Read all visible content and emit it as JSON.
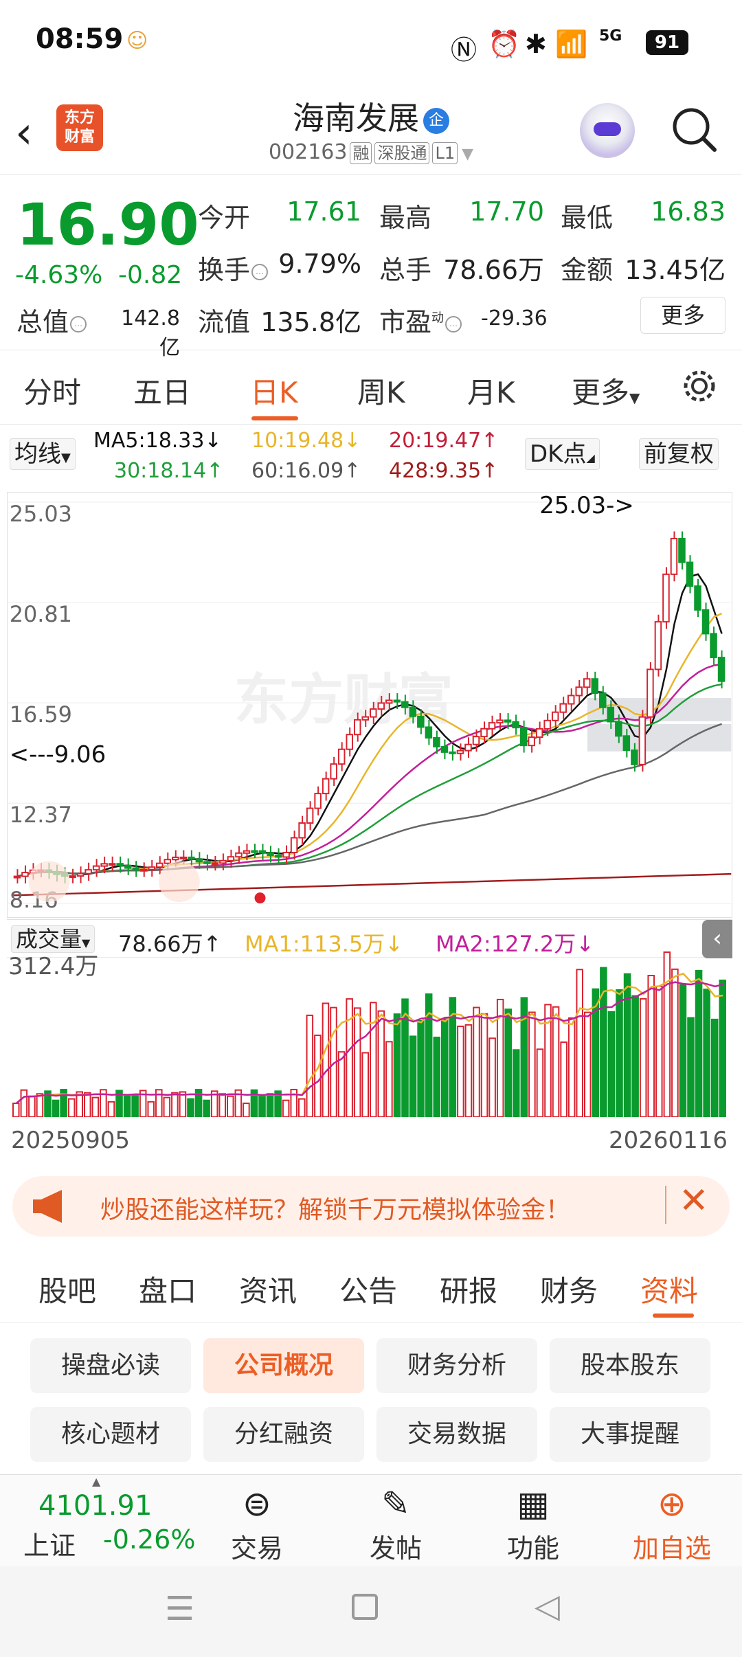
{
  "status_bar": {
    "time": "08:59",
    "battery": "91",
    "network": "5G"
  },
  "header": {
    "name": "海南发展",
    "qi_badge": "企",
    "code": "002163",
    "tags": [
      "融",
      "深股通",
      "L1"
    ],
    "logo_text_1": "东方",
    "logo_text_2": "财富"
  },
  "quote": {
    "price": "16.90",
    "change_pct": "-4.63%",
    "change": "-0.82",
    "open_label": "今开",
    "open": "17.61",
    "high_label": "最高",
    "high": "17.70",
    "low_label": "最低",
    "low": "16.83",
    "turnover_label": "换手",
    "turnover": "9.79%",
    "volume_label": "总手",
    "volume": "78.66万",
    "amount_label": "金额",
    "amount": "13.45亿",
    "mktcap_label": "总值",
    "mktcap": "142.8亿",
    "float_label": "流值",
    "float": "135.8亿",
    "pe_label": "市盈",
    "pe_sup": "动",
    "pe": "-29.36",
    "more": "更多"
  },
  "tabs": [
    "分时",
    "五日",
    "日K",
    "周K",
    "月K",
    "更多"
  ],
  "ma": {
    "selector": "均线",
    "ma5": "MA5:18.33↓",
    "ma10": "10:19.48↓",
    "ma20": "20:19.47↑",
    "ma30": "30:18.14↑",
    "ma60": "60:16.09↑",
    "ma428": "428:9.35↑",
    "dk": "DK点",
    "fq": "前复权"
  },
  "chart_data": {
    "type": "candlestick",
    "y_ticks": [
      "25.03",
      "20.81",
      "16.59",
      "12.37",
      "8.16"
    ],
    "high_marker": "25.03->",
    "low_marker": "<---9.06",
    "ylim": [
      8.16,
      25.03
    ],
    "watermark": "东方财富",
    "volume_label": "成交量",
    "volume_value": "78.66万↑",
    "vol_ma1": "MA1:113.5万↓",
    "vol_ma2": "MA2:127.2万↓",
    "vol_max": "312.4万",
    "x_start": "20250905",
    "x_end": "20260116",
    "colors": {
      "up": "#d8232f",
      "down": "#0a9b2e",
      "ma5": "#111111",
      "ma10": "#e8b52a",
      "ma20": "#c21f9a",
      "ma30": "#1f9e3a",
      "ma60": "#666666",
      "ma428": "#a01c1c"
    }
  },
  "banner": {
    "text": "炒股还能这样玩？解锁千万元模拟体验金！"
  },
  "subtabs": [
    "股吧",
    "盘口",
    "资讯",
    "公告",
    "研报",
    "财务",
    "资料"
  ],
  "grid": [
    [
      "操盘必读",
      "公司概况",
      "财务分析",
      "股本股东"
    ],
    [
      "核心题材",
      "分红融资",
      "交易数据",
      "大事提醒"
    ]
  ],
  "bottom": {
    "index_value": "4101.91",
    "index_name": "上证",
    "index_change": "-0.26%",
    "trade": "交易",
    "post": "发帖",
    "func": "功能",
    "add": "加自选"
  }
}
